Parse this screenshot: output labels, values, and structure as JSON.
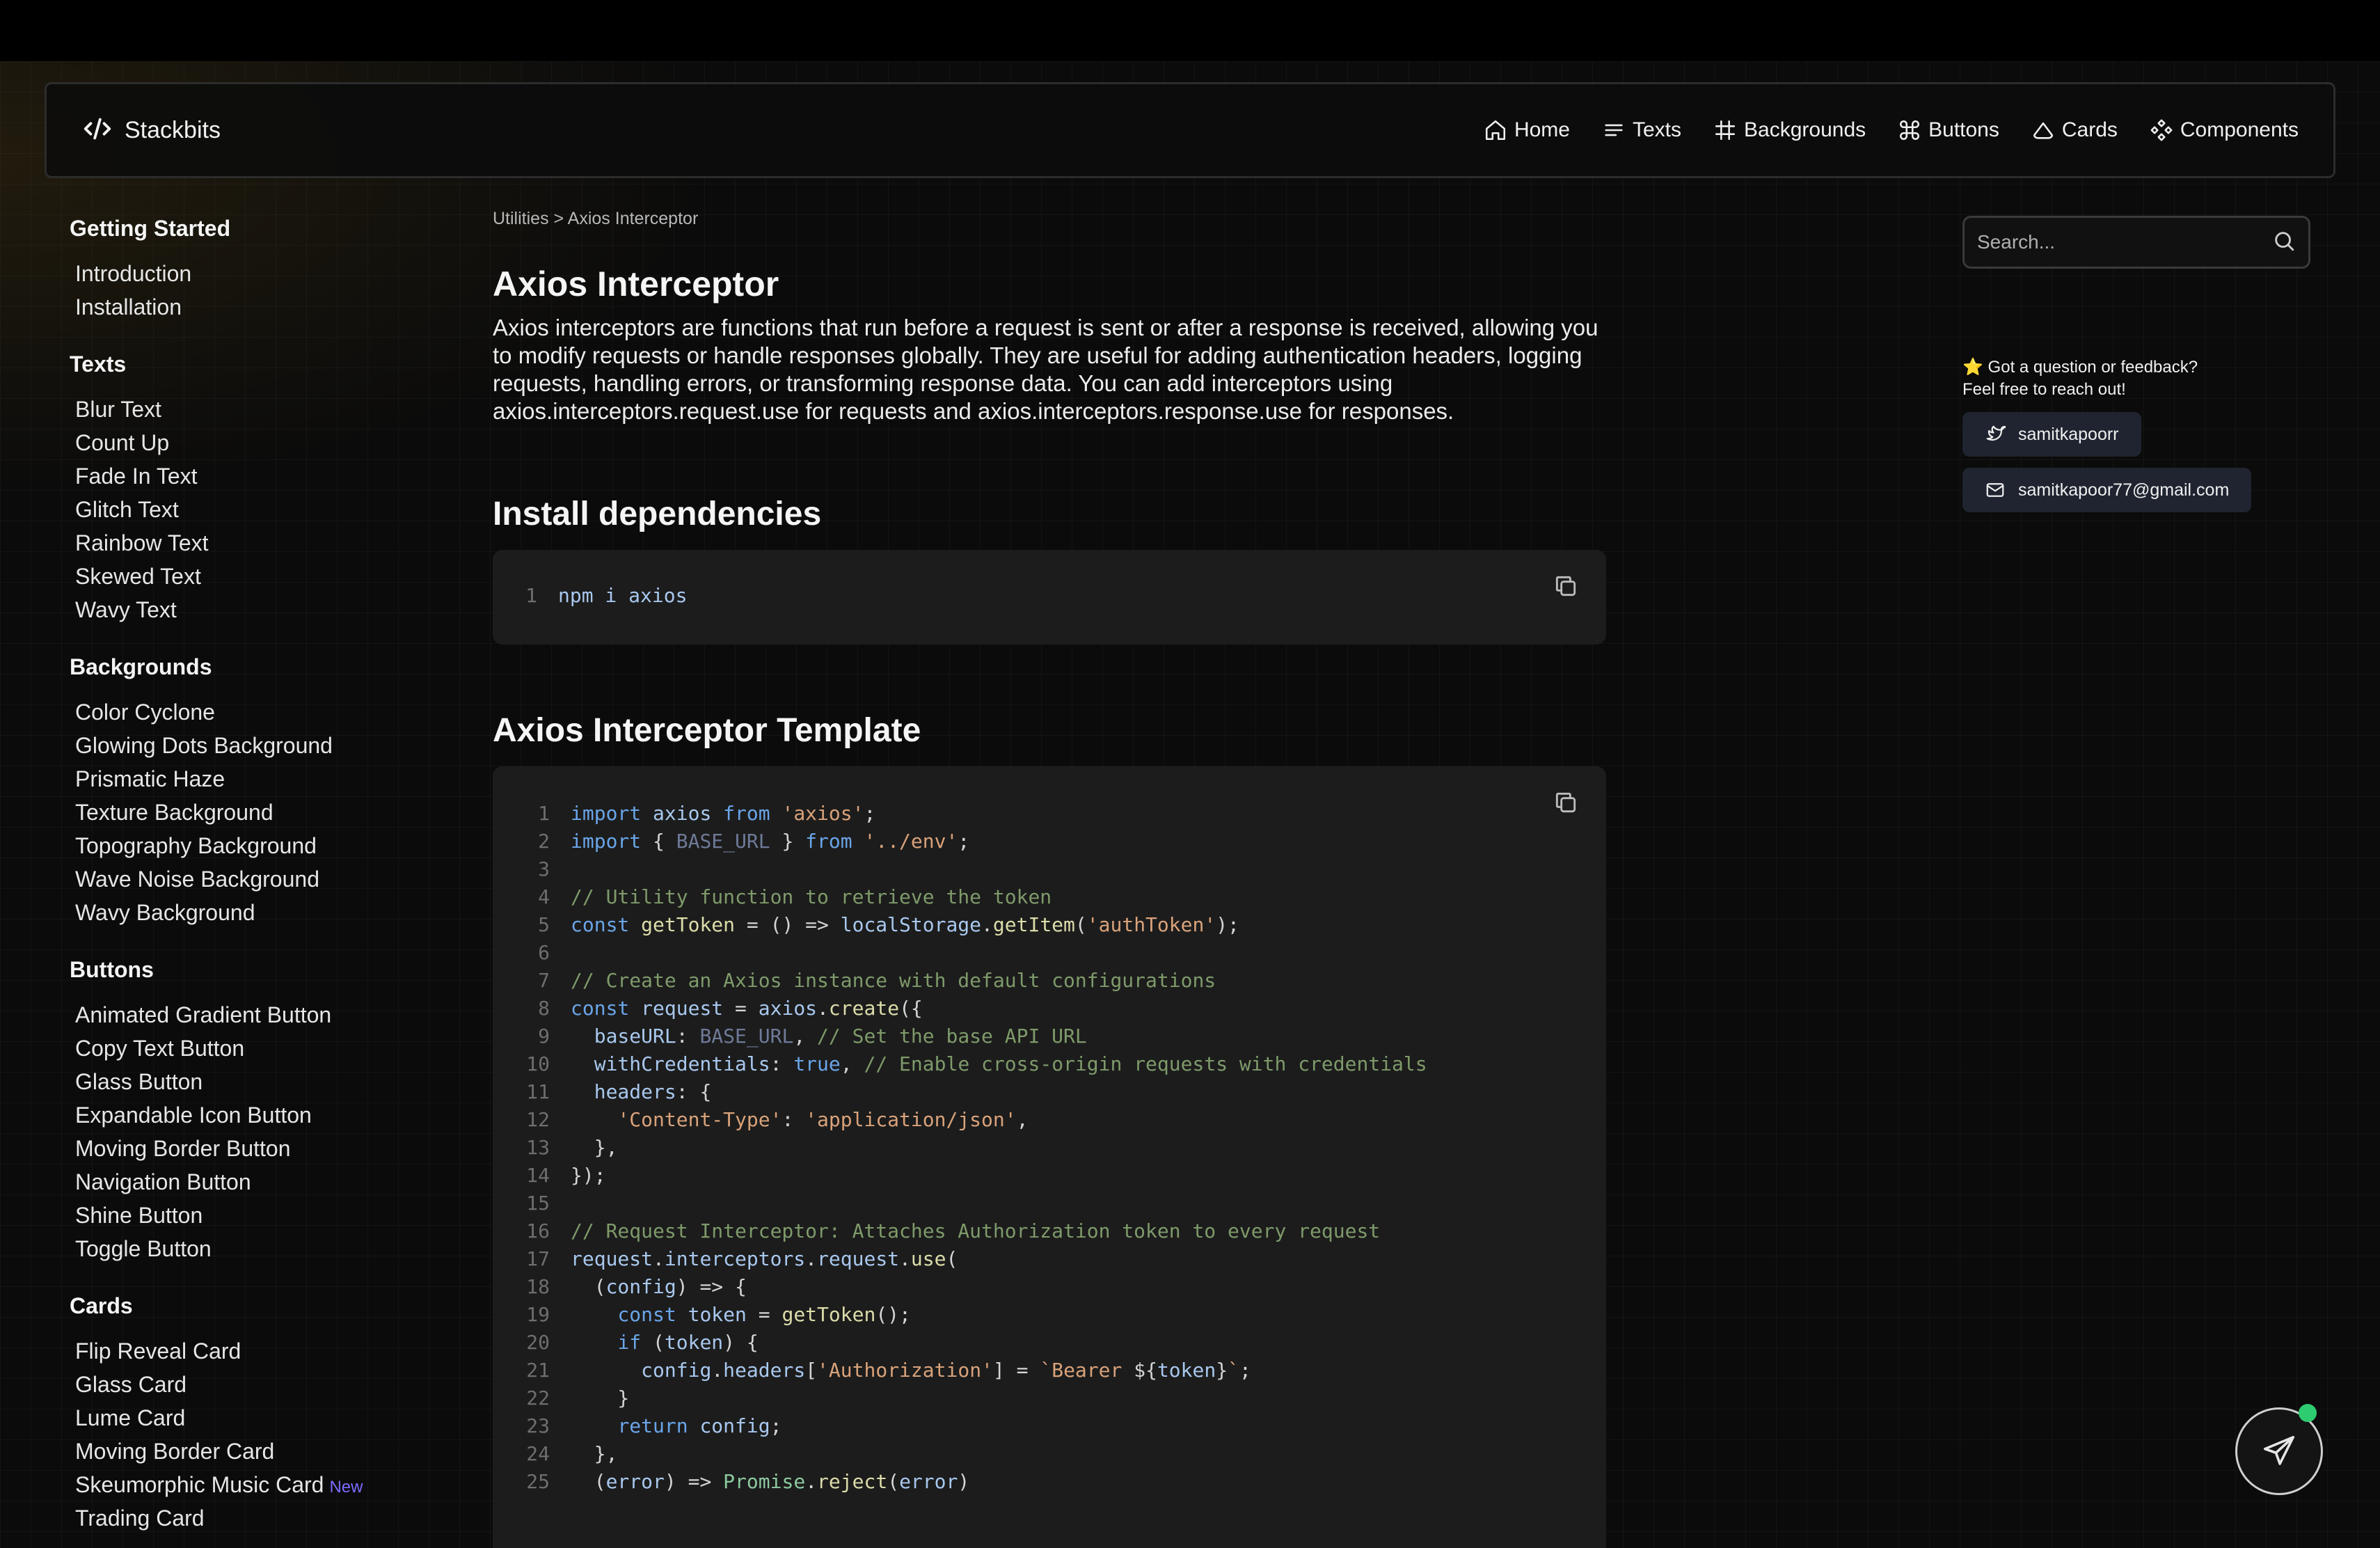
{
  "brand": {
    "name": "Stackbits",
    "logo_icon": "code-icon"
  },
  "nav": [
    {
      "label": "Home",
      "icon": "home-icon"
    },
    {
      "label": "Texts",
      "icon": "lines-icon"
    },
    {
      "label": "Backgrounds",
      "icon": "hash-icon"
    },
    {
      "label": "Buttons",
      "icon": "command-icon"
    },
    {
      "label": "Cards",
      "icon": "cloud-icon"
    },
    {
      "label": "Components",
      "icon": "components-icon"
    }
  ],
  "sidebar": {
    "sections": [
      {
        "title": "Getting Started",
        "items": [
          "Introduction",
          "Installation"
        ]
      },
      {
        "title": "Texts",
        "items": [
          "Blur Text",
          "Count Up",
          "Fade In Text",
          "Glitch Text",
          "Rainbow Text",
          "Skewed Text",
          "Wavy Text"
        ]
      },
      {
        "title": "Backgrounds",
        "items": [
          "Color Cyclone",
          "Glowing Dots Background",
          "Prismatic Haze",
          "Texture Background",
          "Topography Background",
          "Wave Noise Background",
          "Wavy Background"
        ]
      },
      {
        "title": "Buttons",
        "items": [
          "Animated Gradient Button",
          "Copy Text Button",
          "Glass Button",
          "Expandable Icon Button",
          "Moving Border Button",
          "Navigation Button",
          "Shine Button",
          "Toggle Button"
        ]
      },
      {
        "title": "Cards",
        "items": [
          "Flip Reveal Card",
          "Glass Card",
          "Lume Card",
          "Moving Border Card",
          "Skeumorphic Music Card",
          "Trading Card"
        ]
      }
    ],
    "new_badge": {
      "item": "Skeumorphic Music Card",
      "label": "New"
    }
  },
  "main": {
    "breadcrumb": "Utilities > Axios Interceptor",
    "title": "Axios Interceptor",
    "description": "Axios interceptors are functions that run before a request is sent or after a response is received, allowing you to modify requests or handle responses globally. They are useful for adding authentication headers, logging requests, handling errors, or transforming response data. You can add interceptors using axios.interceptors.request.use for requests and axios.interceptors.response.use for responses.",
    "install_heading": "Install dependencies",
    "install_code": [
      {
        "n": "1",
        "tokens": [
          [
            "var",
            "npm i axios"
          ]
        ]
      }
    ],
    "template_heading": "Axios Interceptor Template",
    "template_code": [
      {
        "n": "1",
        "tokens": [
          [
            "kw",
            "import"
          ],
          [
            "pl",
            " "
          ],
          [
            "var",
            "axios"
          ],
          [
            "pl",
            " "
          ],
          [
            "kw",
            "from"
          ],
          [
            "pl",
            " "
          ],
          [
            "str",
            "'axios'"
          ],
          [
            "pl",
            ";"
          ]
        ]
      },
      {
        "n": "2",
        "tokens": [
          [
            "kw",
            "import"
          ],
          [
            "pl",
            " { "
          ],
          [
            "dim",
            "BASE_URL"
          ],
          [
            "pl",
            " } "
          ],
          [
            "kw",
            "from"
          ],
          [
            "pl",
            " "
          ],
          [
            "str",
            "'../env'"
          ],
          [
            "pl",
            ";"
          ]
        ]
      },
      {
        "n": "3",
        "tokens": []
      },
      {
        "n": "4",
        "tokens": [
          [
            "cm",
            "// Utility function to retrieve the token"
          ]
        ]
      },
      {
        "n": "5",
        "tokens": [
          [
            "kw",
            "const"
          ],
          [
            "pl",
            " "
          ],
          [
            "fn",
            "getToken"
          ],
          [
            "pl",
            " = () => "
          ],
          [
            "var",
            "localStorage"
          ],
          [
            "pl",
            "."
          ],
          [
            "fn",
            "getItem"
          ],
          [
            "pl",
            "("
          ],
          [
            "str",
            "'authToken'"
          ],
          [
            "pl",
            ");"
          ]
        ]
      },
      {
        "n": "6",
        "tokens": []
      },
      {
        "n": "7",
        "tokens": [
          [
            "cm",
            "// Create an Axios instance with default configurations"
          ]
        ]
      },
      {
        "n": "8",
        "tokens": [
          [
            "kw",
            "const"
          ],
          [
            "pl",
            " "
          ],
          [
            "var",
            "request"
          ],
          [
            "pl",
            " = "
          ],
          [
            "var",
            "axios"
          ],
          [
            "pl",
            "."
          ],
          [
            "fn",
            "create"
          ],
          [
            "pl",
            "({"
          ]
        ]
      },
      {
        "n": "9",
        "tokens": [
          [
            "pl",
            "  "
          ],
          [
            "var",
            "baseURL"
          ],
          [
            "pl",
            ": "
          ],
          [
            "dim",
            "BASE_URL"
          ],
          [
            "pl",
            ", "
          ],
          [
            "cm",
            "// Set the base API URL"
          ]
        ]
      },
      {
        "n": "10",
        "tokens": [
          [
            "pl",
            "  "
          ],
          [
            "var",
            "withCredentials"
          ],
          [
            "pl",
            ": "
          ],
          [
            "kw",
            "true"
          ],
          [
            "pl",
            ", "
          ],
          [
            "cm",
            "// Enable cross-origin requests with credentials"
          ]
        ]
      },
      {
        "n": "11",
        "tokens": [
          [
            "pl",
            "  "
          ],
          [
            "var",
            "headers"
          ],
          [
            "pl",
            ": {"
          ]
        ]
      },
      {
        "n": "12",
        "tokens": [
          [
            "pl",
            "    "
          ],
          [
            "str",
            "'Content-Type'"
          ],
          [
            "pl",
            ": "
          ],
          [
            "str",
            "'application/json'"
          ],
          [
            "pl",
            ","
          ]
        ]
      },
      {
        "n": "13",
        "tokens": [
          [
            "pl",
            "  },"
          ]
        ]
      },
      {
        "n": "14",
        "tokens": [
          [
            "pl",
            "});"
          ]
        ]
      },
      {
        "n": "15",
        "tokens": []
      },
      {
        "n": "16",
        "tokens": [
          [
            "cm",
            "// Request Interceptor: Attaches Authorization token to every request"
          ]
        ]
      },
      {
        "n": "17",
        "tokens": [
          [
            "var",
            "request"
          ],
          [
            "pl",
            "."
          ],
          [
            "var",
            "interceptors"
          ],
          [
            "pl",
            "."
          ],
          [
            "var",
            "request"
          ],
          [
            "pl",
            "."
          ],
          [
            "fn",
            "use"
          ],
          [
            "pl",
            "("
          ]
        ]
      },
      {
        "n": "18",
        "tokens": [
          [
            "pl",
            "  ("
          ],
          [
            "var",
            "config"
          ],
          [
            "pl",
            ") => {"
          ]
        ]
      },
      {
        "n": "19",
        "tokens": [
          [
            "pl",
            "    "
          ],
          [
            "kw",
            "const"
          ],
          [
            "pl",
            " "
          ],
          [
            "var",
            "token"
          ],
          [
            "pl",
            " = "
          ],
          [
            "fn",
            "getToken"
          ],
          [
            "pl",
            "();"
          ]
        ]
      },
      {
        "n": "20",
        "tokens": [
          [
            "pl",
            "    "
          ],
          [
            "kw",
            "if"
          ],
          [
            "pl",
            " ("
          ],
          [
            "var",
            "token"
          ],
          [
            "pl",
            ") {"
          ]
        ]
      },
      {
        "n": "21",
        "tokens": [
          [
            "pl",
            "      "
          ],
          [
            "var",
            "config"
          ],
          [
            "pl",
            "."
          ],
          [
            "var",
            "headers"
          ],
          [
            "pl",
            "["
          ],
          [
            "str",
            "'Authorization'"
          ],
          [
            "pl",
            "] = "
          ],
          [
            "str",
            "`Bearer "
          ],
          [
            "pl",
            "${"
          ],
          [
            "var",
            "token"
          ],
          [
            "pl",
            "}"
          ],
          [
            "str",
            "`"
          ],
          [
            "pl",
            ";"
          ]
        ]
      },
      {
        "n": "22",
        "tokens": [
          [
            "pl",
            "    }"
          ]
        ]
      },
      {
        "n": "23",
        "tokens": [
          [
            "pl",
            "    "
          ],
          [
            "kw",
            "return"
          ],
          [
            "pl",
            " "
          ],
          [
            "var",
            "config"
          ],
          [
            "pl",
            ";"
          ]
        ]
      },
      {
        "n": "24",
        "tokens": [
          [
            "pl",
            "  },"
          ]
        ]
      },
      {
        "n": "25",
        "tokens": [
          [
            "pl",
            "  ("
          ],
          [
            "var",
            "error"
          ],
          [
            "pl",
            ") => "
          ],
          [
            "gr",
            "Promise"
          ],
          [
            "pl",
            "."
          ],
          [
            "fn",
            "reject"
          ],
          [
            "pl",
            "("
          ],
          [
            "var",
            "error"
          ],
          [
            "pl",
            ")"
          ]
        ]
      }
    ]
  },
  "search": {
    "placeholder": "Search..."
  },
  "feedback": {
    "line1": "⭐ Got a question or feedback?",
    "line2": "Feel free to reach out!",
    "twitter": "samitkapoorr",
    "email": "samitkapoor77@gmail.com"
  },
  "colors": {
    "accent_new": "#7c6cff",
    "online_dot": "#2ecc71"
  }
}
